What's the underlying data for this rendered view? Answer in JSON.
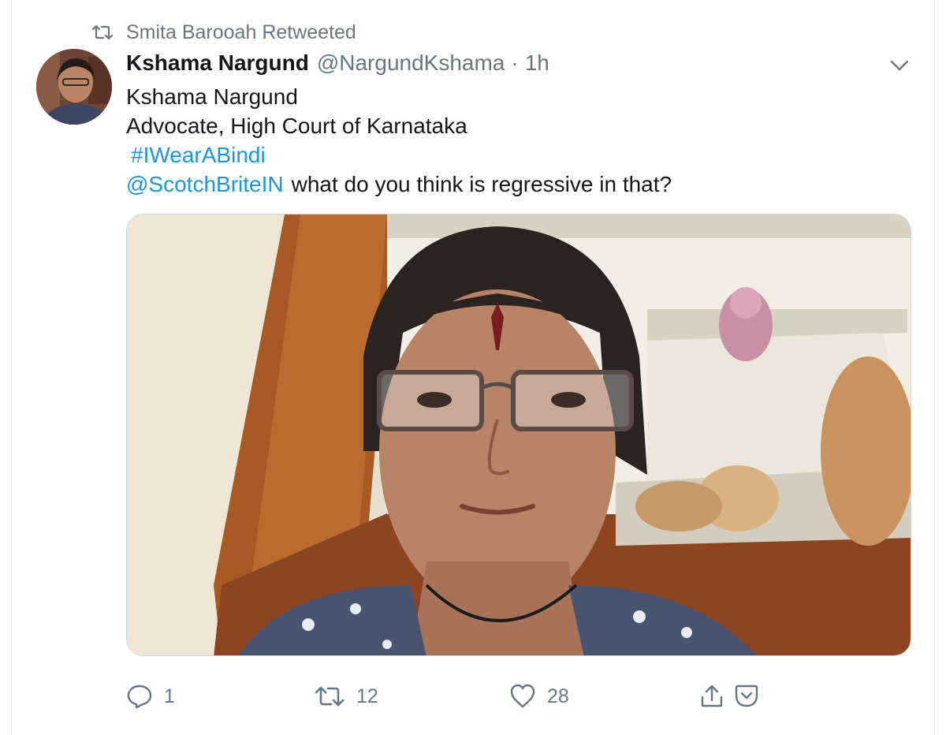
{
  "retweet_context": {
    "text": "Smita Barooah Retweeted",
    "icon": "retweet-icon"
  },
  "tweet": {
    "display_name": "Kshama Nargund",
    "handle": "@NargundKshama",
    "separator": "·",
    "time": "1h",
    "lines": {
      "line1": "Kshama Nargund",
      "line2": "Advocate, High Court of Karnataka",
      "hashtag": "#IWearABindi",
      "mention": "@ScotchBriteIN",
      "mention_rest": "what do you think is regressive in that?"
    }
  },
  "actions": {
    "reply": {
      "count": "1",
      "icon": "reply-icon"
    },
    "retweet": {
      "count": "12",
      "icon": "retweet-icon"
    },
    "like": {
      "count": "28",
      "icon": "heart-icon"
    },
    "share": {
      "icon": "share-icon"
    },
    "save": {
      "icon": "bookmark-icon"
    }
  },
  "colors": {
    "link": "#1b95e0",
    "secondary_text": "#657786",
    "primary_text": "#14171a",
    "border": "#e6ecf0"
  }
}
